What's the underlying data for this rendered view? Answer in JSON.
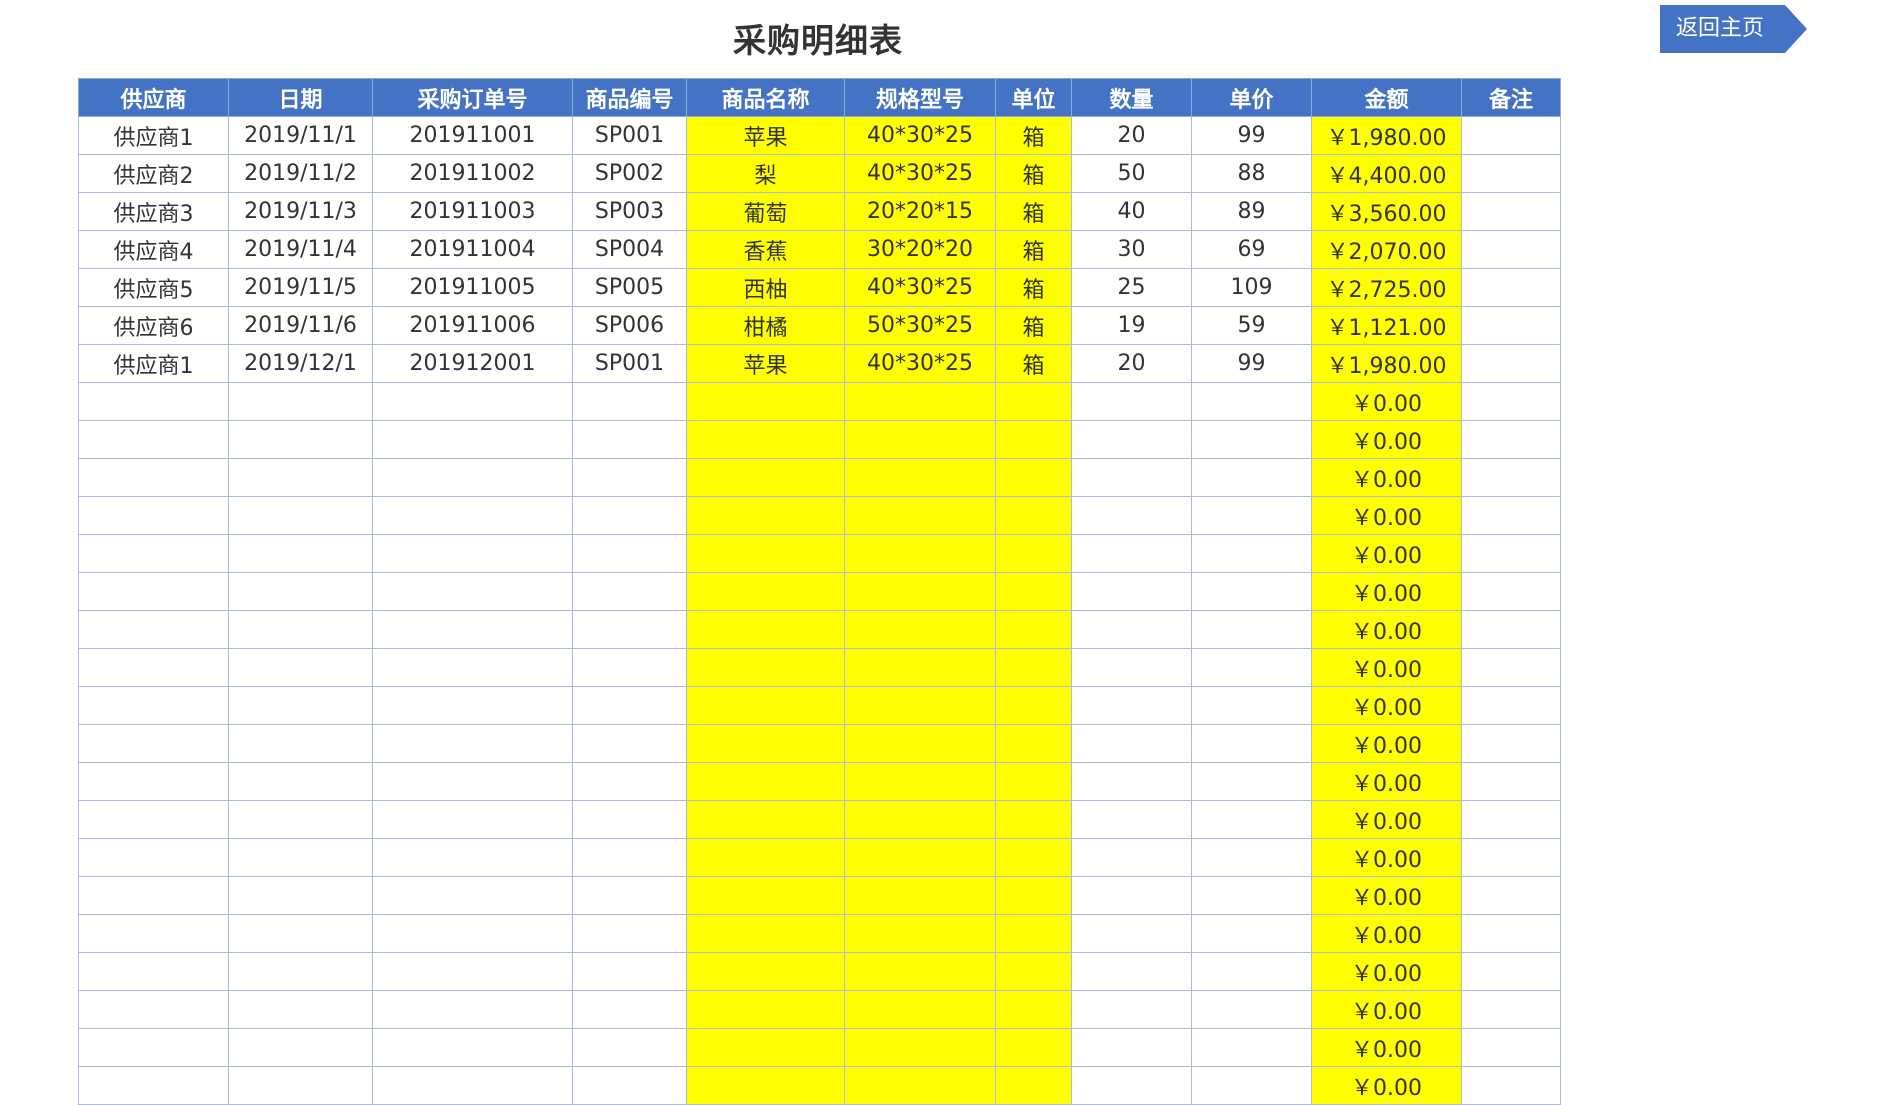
{
  "title": "采购明细表",
  "back_button_label": "返回主页",
  "colors": {
    "header_bg": "#4472c4",
    "highlight": "#ffff00",
    "grid": "#a9bcdc"
  },
  "columns": [
    "供应商",
    "日期",
    "采购订单号",
    "商品编号",
    "商品名称",
    "规格型号",
    "单位",
    "数量",
    "单价",
    "金额",
    "备注"
  ],
  "rows": [
    [
      "供应商1",
      "2019/11/1",
      "201911001",
      "SP001",
      "苹果",
      "40*30*25",
      "箱",
      "20",
      "99",
      "￥1,980.00",
      ""
    ],
    [
      "供应商2",
      "2019/11/2",
      "201911002",
      "SP002",
      "梨",
      "40*30*25",
      "箱",
      "50",
      "88",
      "￥4,400.00",
      ""
    ],
    [
      "供应商3",
      "2019/11/3",
      "201911003",
      "SP003",
      "葡萄",
      "20*20*15",
      "箱",
      "40",
      "89",
      "￥3,560.00",
      ""
    ],
    [
      "供应商4",
      "2019/11/4",
      "201911004",
      "SP004",
      "香蕉",
      "30*20*20",
      "箱",
      "30",
      "69",
      "￥2,070.00",
      ""
    ],
    [
      "供应商5",
      "2019/11/5",
      "201911005",
      "SP005",
      "西柚",
      "40*30*25",
      "箱",
      "25",
      "109",
      "￥2,725.00",
      ""
    ],
    [
      "供应商6",
      "2019/11/6",
      "201911006",
      "SP006",
      "柑橘",
      "50*30*25",
      "箱",
      "19",
      "59",
      "￥1,121.00",
      ""
    ],
    [
      "供应商1",
      "2019/12/1",
      "201912001",
      "SP001",
      "苹果",
      "40*30*25",
      "箱",
      "20",
      "99",
      "￥1,980.00",
      ""
    ],
    [
      "",
      "",
      "",
      "",
      "",
      "",
      "",
      "",
      "",
      "￥0.00",
      ""
    ],
    [
      "",
      "",
      "",
      "",
      "",
      "",
      "",
      "",
      "",
      "￥0.00",
      ""
    ],
    [
      "",
      "",
      "",
      "",
      "",
      "",
      "",
      "",
      "",
      "￥0.00",
      ""
    ],
    [
      "",
      "",
      "",
      "",
      "",
      "",
      "",
      "",
      "",
      "￥0.00",
      ""
    ],
    [
      "",
      "",
      "",
      "",
      "",
      "",
      "",
      "",
      "",
      "￥0.00",
      ""
    ],
    [
      "",
      "",
      "",
      "",
      "",
      "",
      "",
      "",
      "",
      "￥0.00",
      ""
    ],
    [
      "",
      "",
      "",
      "",
      "",
      "",
      "",
      "",
      "",
      "￥0.00",
      ""
    ],
    [
      "",
      "",
      "",
      "",
      "",
      "",
      "",
      "",
      "",
      "￥0.00",
      ""
    ],
    [
      "",
      "",
      "",
      "",
      "",
      "",
      "",
      "",
      "",
      "￥0.00",
      ""
    ],
    [
      "",
      "",
      "",
      "",
      "",
      "",
      "",
      "",
      "",
      "￥0.00",
      ""
    ],
    [
      "",
      "",
      "",
      "",
      "",
      "",
      "",
      "",
      "",
      "￥0.00",
      ""
    ],
    [
      "",
      "",
      "",
      "",
      "",
      "",
      "",
      "",
      "",
      "￥0.00",
      ""
    ],
    [
      "",
      "",
      "",
      "",
      "",
      "",
      "",
      "",
      "",
      "￥0.00",
      ""
    ],
    [
      "",
      "",
      "",
      "",
      "",
      "",
      "",
      "",
      "",
      "￥0.00",
      ""
    ],
    [
      "",
      "",
      "",
      "",
      "",
      "",
      "",
      "",
      "",
      "￥0.00",
      ""
    ],
    [
      "",
      "",
      "",
      "",
      "",
      "",
      "",
      "",
      "",
      "￥0.00",
      ""
    ],
    [
      "",
      "",
      "",
      "",
      "",
      "",
      "",
      "",
      "",
      "￥0.00",
      ""
    ],
    [
      "",
      "",
      "",
      "",
      "",
      "",
      "",
      "",
      "",
      "￥0.00",
      ""
    ],
    [
      "",
      "",
      "",
      "",
      "",
      "",
      "",
      "",
      "",
      "￥0.00",
      ""
    ]
  ]
}
